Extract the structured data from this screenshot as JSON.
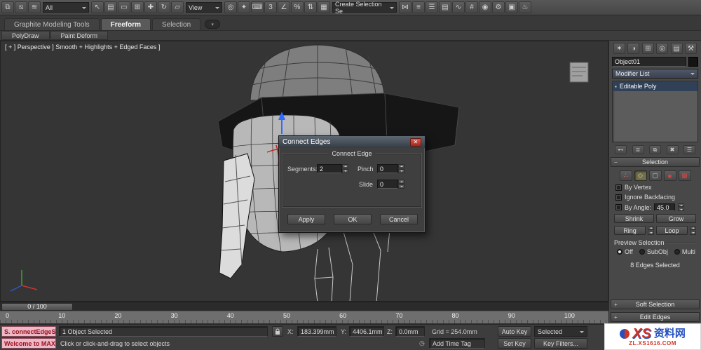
{
  "icons": {
    "close": "✕",
    "minus": "−",
    "plus": "+",
    "ribbon_menu": "▾",
    "stack_item_glyph": "▪",
    "clock": "◷"
  },
  "toolbar": {
    "group1": [
      {
        "name": "select-and-link-icon",
        "glyph": "⧉"
      },
      {
        "name": "unlink-selection-icon",
        "glyph": "⧅"
      },
      {
        "name": "bind-to-space-warp-icon",
        "glyph": "≋"
      }
    ],
    "filter_label": "All",
    "group2": [
      {
        "name": "select-object-icon",
        "glyph": "↖"
      },
      {
        "name": "select-by-name-icon",
        "glyph": "▤"
      },
      {
        "name": "rectangular-selection-region-icon",
        "glyph": "▭"
      },
      {
        "name": "window-crossing-icon",
        "glyph": "⊞"
      },
      {
        "name": "select-and-move-icon",
        "glyph": "✚"
      },
      {
        "name": "select-and-rotate-icon",
        "glyph": "↻"
      },
      {
        "name": "select-and-scale-icon",
        "glyph": "▱"
      }
    ],
    "view_label": "View",
    "group3": [
      {
        "name": "use-pivot-center-icon",
        "glyph": "◎"
      },
      {
        "name": "select-and-manipulate-icon",
        "glyph": "✦"
      },
      {
        "name": "keyboard-override-icon",
        "glyph": "⌨"
      },
      {
        "name": "snaps-toggle-icon",
        "glyph": "3"
      },
      {
        "name": "angle-snap-icon",
        "glyph": "∠"
      },
      {
        "name": "percent-snap-icon",
        "glyph": "%"
      },
      {
        "name": "spinner-snap-icon",
        "glyph": "⇅"
      },
      {
        "name": "named-selection-sets-icon",
        "glyph": "▦"
      }
    ],
    "selection_set_label": "Create Selection Se",
    "group4": [
      {
        "name": "mirror-icon",
        "glyph": "⋈"
      },
      {
        "name": "align-icon",
        "glyph": "≡"
      },
      {
        "name": "layer-manager-icon",
        "glyph": "☰"
      },
      {
        "name": "graphite-ribbon-toggle-icon",
        "glyph": "▤"
      },
      {
        "name": "curve-editor-icon",
        "glyph": "∿"
      },
      {
        "name": "schematic-view-icon",
        "glyph": "#"
      },
      {
        "name": "material-editor-icon",
        "glyph": "◉"
      },
      {
        "name": "render-setup-icon",
        "glyph": "⚙"
      },
      {
        "name": "rendered-frame-icon",
        "glyph": "▣"
      },
      {
        "name": "render-production-icon",
        "glyph": "♨"
      }
    ]
  },
  "ribbon": {
    "tabs": [
      "Graphite Modeling Tools",
      "Freeform",
      "Selection"
    ],
    "subtabs": [
      "PolyDraw",
      "Paint Deform"
    ]
  },
  "viewport": {
    "label": "[ + ] Perspective ] Smooth + Highlights + Edged Faces ]"
  },
  "dialog": {
    "title": "Connect Edges",
    "group_label": "Connect Edge",
    "segments_label": "Segments:",
    "segments_value": "2",
    "pinch_label": "Pinch",
    "pinch_value": "0",
    "slide_label": "Slide",
    "slide_value": "0",
    "apply": "Apply",
    "ok": "OK",
    "cancel": "Cancel"
  },
  "rpanel": {
    "tabs": [
      {
        "name": "create-tab-icon",
        "glyph": "✶"
      },
      {
        "name": "modify-tab-icon",
        "glyph": "◑"
      },
      {
        "name": "hierarchy-tab-icon",
        "glyph": "⊞"
      },
      {
        "name": "motion-tab-icon",
        "glyph": "◎"
      },
      {
        "name": "display-tab-icon",
        "glyph": "▤"
      },
      {
        "name": "utilities-tab-icon",
        "glyph": "⚒"
      }
    ],
    "object_name": "Object01",
    "modifier_list": "Modifier List",
    "stack_item": "Editable Poly",
    "stack_tools": [
      {
        "name": "pin-stack-icon",
        "glyph": "⊷"
      },
      {
        "name": "show-end-result-icon",
        "glyph": "≣"
      },
      {
        "name": "make-unique-icon",
        "glyph": "⧉"
      },
      {
        "name": "remove-modifier-icon",
        "glyph": "✖"
      },
      {
        "name": "configure-modifier-sets-icon",
        "glyph": "☰"
      }
    ],
    "selection": {
      "title": "Selection",
      "subobject": {
        "vertex": "∴",
        "edge": "◇",
        "border": "▢",
        "polygon": "■",
        "element": "▩"
      },
      "by_vertex": "By Vertex",
      "ignore_backfacing": "Ignore Backfacing",
      "by_angle": "By Angle:",
      "by_angle_value": "45.0",
      "shrink": "Shrink",
      "grow": "Grow",
      "ring": "Ring",
      "loop": "Loop",
      "preview": "Preview Selection",
      "preview_options": [
        "Off",
        "SubObj",
        "Multi"
      ],
      "status": "8 Edges Selected"
    },
    "soft_selection": "Soft Selection",
    "edit_edges": "Edit Edges"
  },
  "timeline": {
    "range": "0 / 100",
    "ticks": [
      "0",
      "10",
      "20",
      "30",
      "40",
      "50",
      "60",
      "70",
      "80",
      "90",
      "100"
    ]
  },
  "status": {
    "script_recorder": "S. connectEdgeS",
    "script_listener": "Welcome to MAX!",
    "selection_info": "1 Object Selected",
    "prompt": "Click or click-and-drag to select objects",
    "x_label": "X:",
    "x_value": "183.399mm",
    "y_label": "Y:",
    "y_value": "4406.1mm",
    "z_label": "Z:",
    "z_value": "0.0mm",
    "grid": "Grid = 254.0mm",
    "add_time_tag": "Add Time Tag",
    "auto_key": "Auto Key",
    "selected_dropdown": "Selected",
    "set_key": "Set Key",
    "key_filters": "Key Filters..."
  },
  "watermark": {
    "xs": "XS",
    "name": "资料网",
    "url": "ZL.XS1616.COM"
  }
}
